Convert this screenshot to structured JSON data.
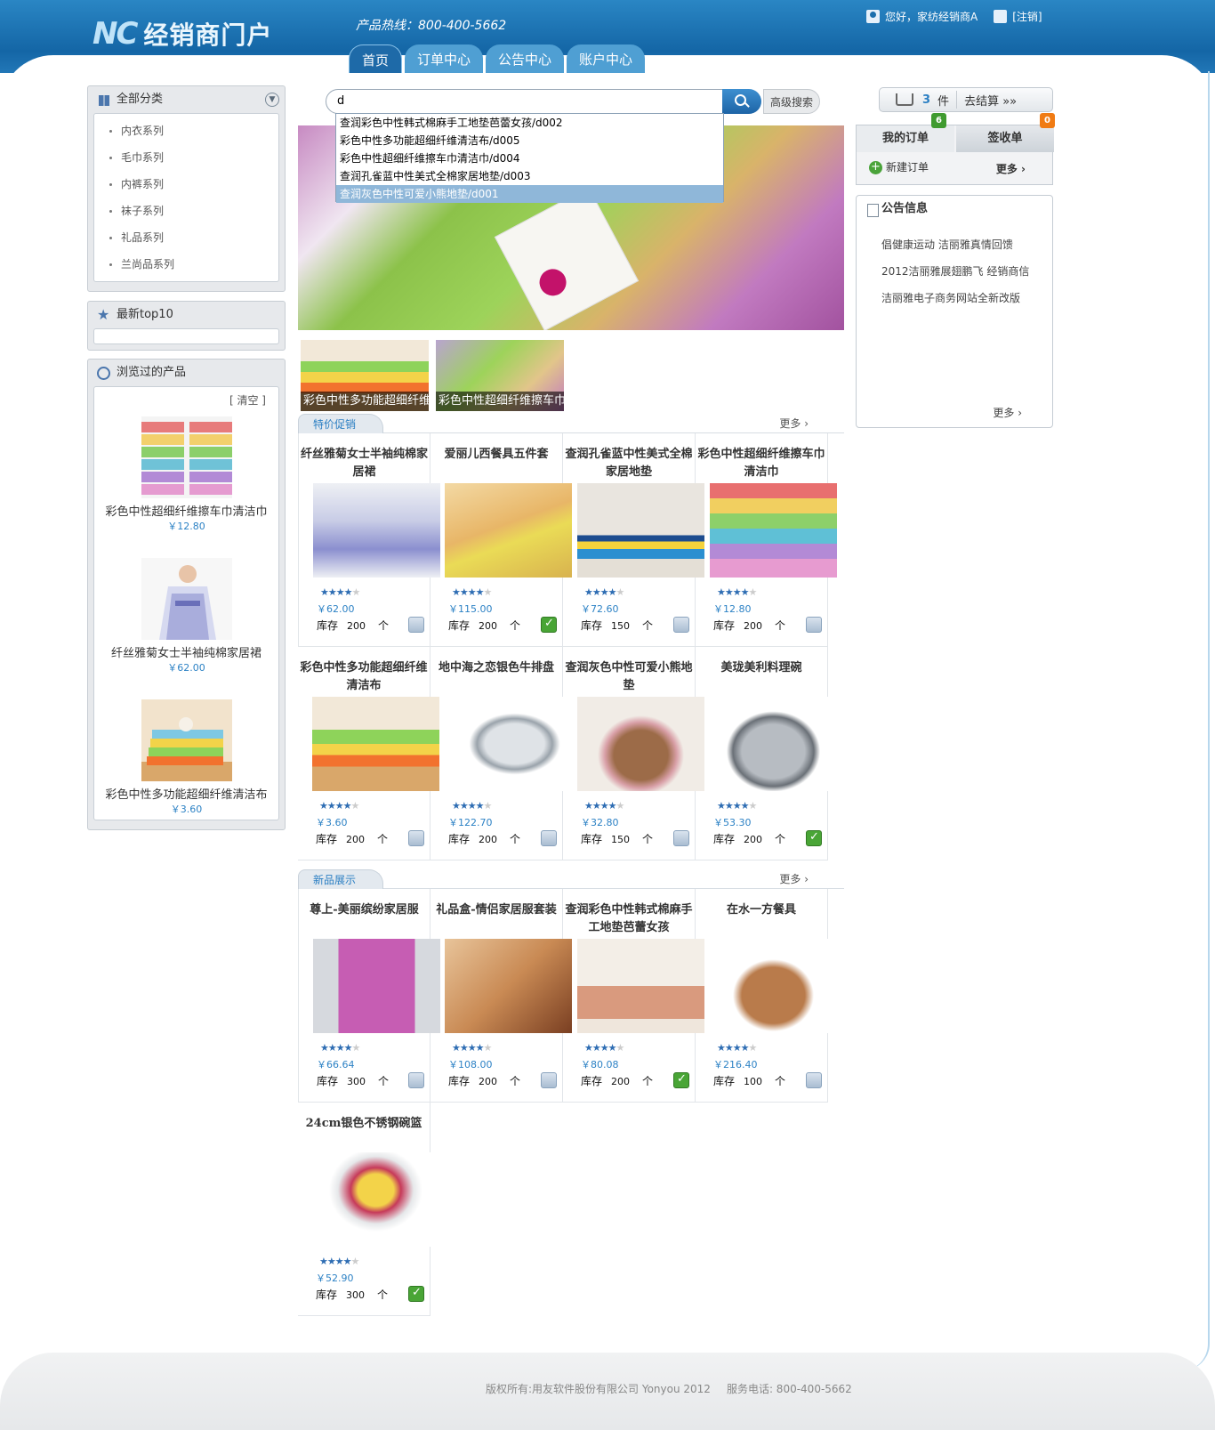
{
  "header": {
    "logo_mark": "NC",
    "logo_text": "经销商门户",
    "hotline": "产品热线：800-400-5662",
    "greeting": "您好，家纺经销商A",
    "logout": "[注销]",
    "nav": [
      "首页",
      "订单中心",
      "公告中心",
      "账户中心"
    ]
  },
  "left": {
    "categories_title": "全部分类",
    "categories": [
      "内衣系列",
      "毛巾系列",
      "内裤系列",
      "袜子系列",
      "礼品系列",
      "兰尚品系列"
    ],
    "top10_title": "最新top10",
    "viewed_title": "浏览过的产品",
    "viewed_clear": "[ 清空 ]",
    "viewed": [
      {
        "name": "彩色中性超细纤维擦车巾清洁巾",
        "price": "￥12.80"
      },
      {
        "name": "纤丝雅菊女士半袖纯棉家居裙",
        "price": "￥62.00"
      },
      {
        "name": "彩色中性多功能超细纤维清洁布",
        "price": "￥3.60"
      }
    ]
  },
  "search": {
    "query": "d",
    "advanced": "高级搜索",
    "suggestions": [
      "查润彩色中性韩式棉麻手工地垫芭蕾女孩/d002",
      "彩色中性多功能超细纤维清洁布/d005",
      "彩色中性超细纤维擦车巾清洁巾/d004",
      "查润孔雀蓝中性美式全棉家居地垫/d003",
      "查润灰色中性可爱小熊地垫/d001"
    ]
  },
  "banner_thumbs": [
    "彩色中性多功能超细纤维",
    "彩色中性超细纤维擦车巾"
  ],
  "sections": {
    "promo_title": "特价促销",
    "new_title": "新品展示",
    "more": "更多"
  },
  "stock_label": "库存",
  "unit_label": "个",
  "promo_products": [
    {
      "name": "纤丝雅菊女士半袖纯棉家居裙",
      "price": "￥62.00",
      "stock": "200",
      "rating": 4,
      "in_cart": false
    },
    {
      "name": "爱丽儿西餐具五件套",
      "price": "￥115.00",
      "stock": "200",
      "rating": 4,
      "in_cart": true
    },
    {
      "name": "查润孔雀蓝中性美式全棉家居地垫",
      "price": "￥72.60",
      "stock": "150",
      "rating": 4,
      "in_cart": false
    },
    {
      "name": "彩色中性超细纤维擦车巾清洁巾",
      "price": "￥12.80",
      "stock": "200",
      "rating": 4,
      "in_cart": false
    },
    {
      "name": "彩色中性多功能超细纤维清洁布",
      "price": "￥3.60",
      "stock": "200",
      "rating": 4,
      "in_cart": false
    },
    {
      "name": "地中海之恋银色牛排盘",
      "price": "￥122.70",
      "stock": "200",
      "rating": 4,
      "in_cart": false
    },
    {
      "name": "查润灰色中性可爱小熊地垫",
      "price": "￥32.80",
      "stock": "150",
      "rating": 4,
      "in_cart": false
    },
    {
      "name": "美珑美利料理碗",
      "price": "￥53.30",
      "stock": "200",
      "rating": 4,
      "in_cart": true
    }
  ],
  "new_products": [
    {
      "name": "尊上-美丽缤纷家居服",
      "price": "￥66.64",
      "stock": "300",
      "rating": 4,
      "in_cart": false
    },
    {
      "name": "礼品盒-情侣家居服套装",
      "price": "￥108.00",
      "stock": "200",
      "rating": 4,
      "in_cart": false
    },
    {
      "name": "查润彩色中性韩式棉麻手工地垫芭蕾女孩",
      "price": "￥80.08",
      "stock": "200",
      "rating": 4,
      "in_cart": true
    },
    {
      "name": "在水一方餐具",
      "price": "￥216.40",
      "stock": "100",
      "rating": 4,
      "in_cart": false
    },
    {
      "name": "24cm银色不锈钢碗篮",
      "price": "￥52.90",
      "stock": "300",
      "rating": 4,
      "in_cart": true
    }
  ],
  "right": {
    "cart_count": "3",
    "cart_unit": "件",
    "checkout": "去结算 »»",
    "tab_orders": "我的订单",
    "tab_orders_badge": "6",
    "tab_sign": "签收单",
    "tab_sign_badge": "0",
    "new_order": "新建订单",
    "more": "更多",
    "notice_title": "公告信息",
    "notices": [
      "倡健康运动 洁丽雅真情回馈",
      "2012洁丽雅展翅鹏飞 经销商信",
      "洁丽雅电子商务网站全新改版"
    ],
    "colors": {
      "badge_green": "#3f9b2f",
      "badge_orange": "#f07b13"
    }
  },
  "footer": {
    "copyright": "版权所有:用友软件股份有限公司 Yonyou 2012",
    "service": "服务电话: 800-400-5662"
  }
}
